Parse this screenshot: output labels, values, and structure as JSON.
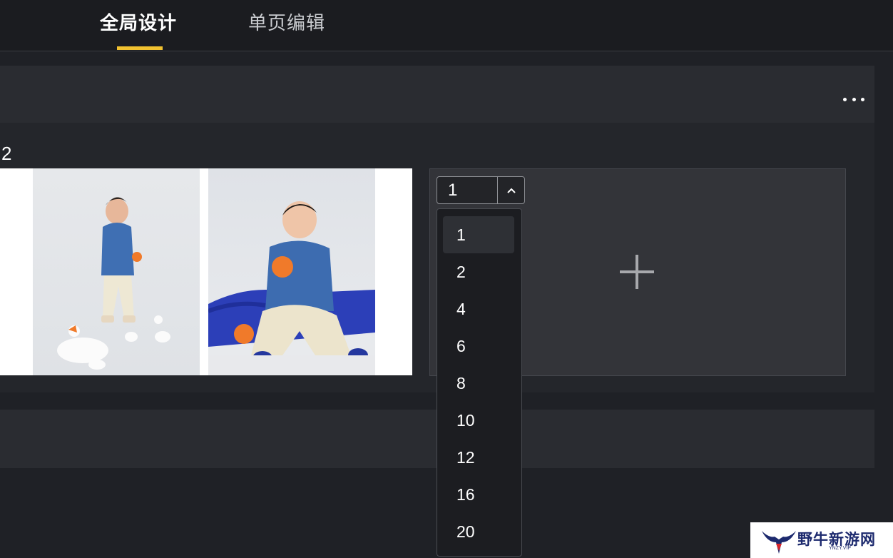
{
  "tabs": [
    {
      "label": "全局设计",
      "active": true
    },
    {
      "label": "单页编辑",
      "active": false
    }
  ],
  "accent_color": "#f2c230",
  "page": {
    "number": "2",
    "more_icon": "more-horizontal-icon",
    "empty_slot_icon": "plus-icon"
  },
  "photo_count_select": {
    "value": "1",
    "arrow_icon": "chevron-up-icon",
    "options": [
      "1",
      "2",
      "4",
      "6",
      "8",
      "10",
      "12",
      "16",
      "20"
    ],
    "selected_index": 0
  },
  "watermark": {
    "text": "野牛新游网",
    "sub": "YNZY.VIP",
    "icon": "bull-logo-icon"
  }
}
